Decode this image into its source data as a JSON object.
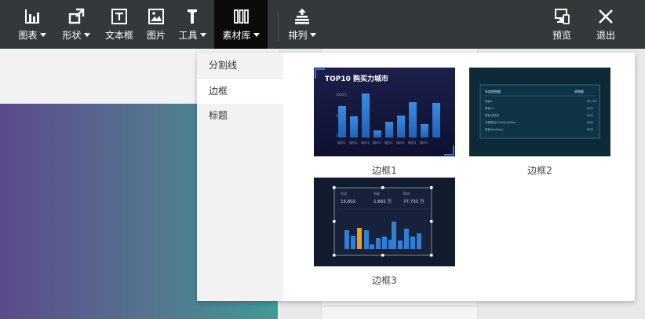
{
  "toolbar": {
    "items": [
      {
        "label": "图表",
        "icon": "bar-chart-icon",
        "dropdown": true
      },
      {
        "label": "形状",
        "icon": "shape-icon",
        "dropdown": true
      },
      {
        "label": "文本框",
        "icon": "text-box-icon",
        "dropdown": false
      },
      {
        "label": "图片",
        "icon": "image-icon",
        "dropdown": false
      },
      {
        "label": "工具",
        "icon": "tool-icon",
        "dropdown": true
      },
      {
        "label": "素材库",
        "icon": "material-library-icon",
        "dropdown": true,
        "active": true
      },
      {
        "label": "排列",
        "icon": "arrange-icon",
        "dropdown": true
      }
    ],
    "preview_label": "预览",
    "exit_label": "退出"
  },
  "material_menu": {
    "items": [
      "分割线",
      "边框",
      "标题"
    ],
    "selected": "边框"
  },
  "thumbnails": [
    {
      "label": "边框1",
      "title": "TOP10 购买力城市",
      "y_ticks": [
        "1000万",
        "500万",
        "100万"
      ],
      "x_ticks": [
        "城市1",
        "城市1",
        "城市1",
        "城市1",
        "城市1",
        "城市1",
        "城市1",
        "城市1"
      ]
    },
    {
      "label": "边框2",
      "header_left": "年度销售额",
      "header_right": "销售额",
      "rows": [
        {
          "name": "类目1",
          "value": "80,125"
        },
        {
          "name": "类目2-1",
          "value": "60万"
        },
        {
          "name": "类目1类目2",
          "value": "60万"
        },
        {
          "name": "无框类目3.00%(million)",
          "value": "60万"
        },
        {
          "name": "类目4(million)",
          "value": "60万"
        }
      ]
    },
    {
      "label": "边框3",
      "kpis": [
        {
          "name": "利润",
          "value": "15,602"
        },
        {
          "name": "销量",
          "value": "1,602 万"
        },
        {
          "name": "客单",
          "value": "77,731 万"
        }
      ]
    }
  ],
  "colors": {
    "toolbar_bg": "#33393b",
    "active_tool_bg": "#0b0b0b",
    "bar_blue": "#2f7fd6",
    "bar_highlight": "#e8a020"
  }
}
